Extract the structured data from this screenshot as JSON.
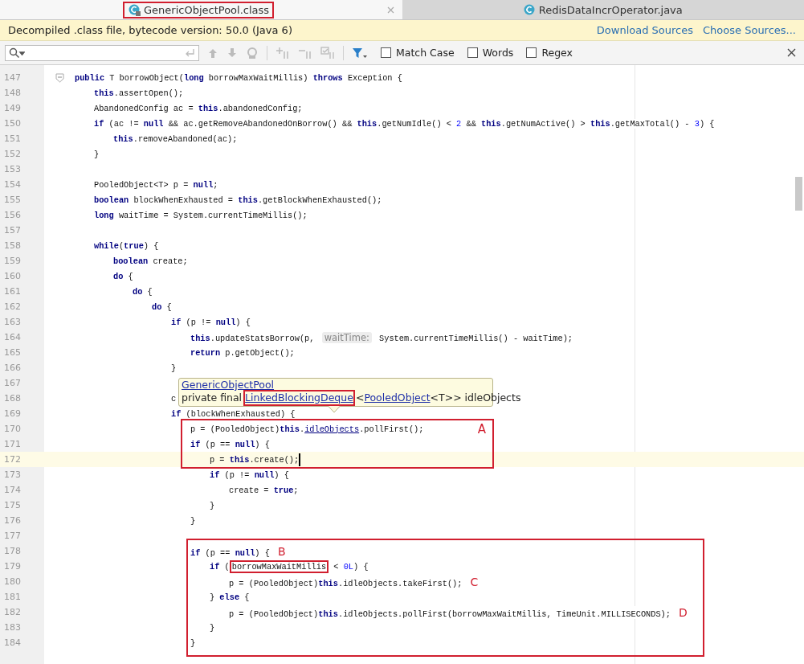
{
  "tabs": [
    {
      "label": "GenericObjectPool.class",
      "selected": true,
      "locked": true,
      "boxed": true
    },
    {
      "label": "RedisDataIncrOperator.java",
      "selected": false,
      "locked": false,
      "boxed": false
    }
  ],
  "banner": {
    "text": "Decompiled .class file, bytecode version: 50.0 (Java 6)",
    "links": [
      "Download Sources",
      "Choose Sources..."
    ]
  },
  "search": {
    "options": [
      {
        "label": "Match Case",
        "checked": false
      },
      {
        "label": "Words",
        "checked": false
      },
      {
        "label": "Regex",
        "checked": false
      }
    ]
  },
  "code": {
    "fold_first_line": true,
    "annotations": [
      {
        "kind": "box",
        "label": "A"
      },
      {
        "kind": "box"
      }
    ],
    "lines": [
      {
        "n": "147",
        "current": false,
        "in_box": false,
        "tokens": [
          {
            "kind": "keyword",
            "text": "public"
          },
          {
            "kind": "plain",
            "text": " T borrowObject("
          },
          {
            "kind": "keyword",
            "text": "long"
          },
          {
            "kind": "plain",
            "text": " borrowMaxWaitMillis) "
          },
          {
            "kind": "keyword",
            "text": "throws"
          },
          {
            "kind": "plain",
            "text": " Exception {"
          }
        ],
        "children": [
          {
            "n": "148",
            "current": false,
            "in_box": false,
            "tokens": [
              {
                "kind": "keyword",
                "text": "this"
              },
              {
                "kind": "plain",
                "text": ".assertOpen();"
              }
            ]
          },
          {
            "n": "149",
            "current": false,
            "in_box": false,
            "tokens": [
              {
                "kind": "plain",
                "text": "AbandonedConfig ac = "
              },
              {
                "kind": "keyword",
                "text": "this"
              },
              {
                "kind": "plain",
                "text": ".abandonedConfig;"
              }
            ]
          },
          {
            "n": "150",
            "current": false,
            "in_box": false,
            "tokens": [
              {
                "kind": "keyword",
                "text": "if"
              },
              {
                "kind": "plain",
                "text": " (ac != "
              },
              {
                "kind": "keyword",
                "text": "null"
              },
              {
                "kind": "plain",
                "text": " && ac.getRemoveAbandonedOnBorrow() && "
              },
              {
                "kind": "keyword",
                "text": "this"
              },
              {
                "kind": "plain",
                "text": ".getNumIdle() < "
              },
              {
                "kind": "number",
                "text": "2"
              },
              {
                "kind": "plain",
                "text": " && "
              },
              {
                "kind": "keyword",
                "text": "this"
              },
              {
                "kind": "plain",
                "text": ".getNumActive() > "
              },
              {
                "kind": "keyword",
                "text": "this"
              },
              {
                "kind": "plain",
                "text": ".getMaxTotal() - "
              },
              {
                "kind": "number",
                "text": "3"
              },
              {
                "kind": "plain",
                "text": ") {"
              }
            ],
            "children": [
              {
                "n": "151",
                "current": false,
                "in_box": false,
                "tokens": [
                  {
                    "kind": "keyword",
                    "text": "this"
                  },
                  {
                    "kind": "plain",
                    "text": ".removeAbandoned(ac);"
                  }
                ]
              }
            ]
          },
          {
            "n": "152",
            "current": false,
            "in_box": false,
            "tokens": [
              {
                "kind": "plain",
                "text": "}"
              }
            ]
          },
          {
            "n": "153",
            "current": false,
            "in_box": false
          },
          {
            "n": "154",
            "current": false,
            "in_box": false,
            "tokens": [
              {
                "kind": "plain",
                "text": "PooledObject<T> p = "
              },
              {
                "kind": "keyword",
                "text": "null"
              },
              {
                "kind": "plain",
                "text": ";"
              }
            ]
          },
          {
            "n": "155",
            "current": false,
            "in_box": false,
            "tokens": [
              {
                "kind": "keyword",
                "text": "boolean"
              },
              {
                "kind": "plain",
                "text": " blockWhenExhausted = "
              },
              {
                "kind": "keyword",
                "text": "this"
              },
              {
                "kind": "plain",
                "text": ".getBlockWhenExhausted();"
              }
            ]
          },
          {
            "n": "156",
            "current": false,
            "in_box": false,
            "tokens": [
              {
                "kind": "keyword",
                "text": "long"
              },
              {
                "kind": "plain",
                "text": " waitTime = System.currentTimeMillis();"
              }
            ]
          },
          {
            "n": "157",
            "current": false,
            "in_box": false
          },
          {
            "n": "158",
            "current": false,
            "in_box": false,
            "tokens": [
              {
                "kind": "keyword",
                "text": "while"
              },
              {
                "kind": "plain",
                "text": "("
              },
              {
                "kind": "keyword",
                "text": "true"
              },
              {
                "kind": "plain",
                "text": ") {"
              }
            ],
            "children": [
              {
                "n": "159",
                "current": false,
                "in_box": false,
                "tokens": [
                  {
                    "kind": "keyword",
                    "text": "boolean"
                  },
                  {
                    "kind": "plain",
                    "text": " create;"
                  }
                ]
              },
              {
                "n": "160",
                "current": false,
                "in_box": false,
                "tokens": [
                  {
                    "kind": "keyword",
                    "text": "do"
                  },
                  {
                    "kind": "plain",
                    "text": " {"
                  }
                ],
                "children": [
                  {
                    "n": "161",
                    "current": false,
                    "in_box": false,
                    "tokens": [
                      {
                        "kind": "keyword",
                        "text": "do"
                      },
                      {
                        "kind": "plain",
                        "text": " {"
                      }
                    ],
                    "children": [
                      {
                        "n": "162",
                        "current": false,
                        "in_box": false,
                        "tokens": [
                          {
                            "kind": "keyword",
                            "text": "do"
                          },
                          {
                            "kind": "plain",
                            "text": " {"
                          }
                        ],
                        "children": [
                          {
                            "n": "163",
                            "current": false,
                            "in_box": false,
                            "tokens": [
                              {
                                "kind": "keyword",
                                "text": "if"
                              },
                              {
                                "kind": "plain",
                                "text": " (p != "
                              },
                              {
                                "kind": "keyword",
                                "text": "null"
                              },
                              {
                                "kind": "plain",
                                "text": ") {"
                              }
                            ],
                            "children": [
                              {
                                "n": "164",
                                "current": false,
                                "in_box": false,
                                "tokens": [
                                  {
                                    "kind": "keyword",
                                    "text": "this"
                                  },
                                  {
                                    "kind": "plain",
                                    "text": ".updateStatsBorrow(p, "
                                  },
                                  {
                                    "kind": "hint",
                                    "text": "waitTime:"
                                  },
                                  {
                                    "kind": "plain",
                                    "text": " System.currentTimeMillis() - waitTime);"
                                  }
                                ]
                              },
                              {
                                "n": "165",
                                "current": false,
                                "in_box": false,
                                "tokens": [
                                  {
                                    "kind": "keyword",
                                    "text": "return"
                                  },
                                  {
                                    "kind": "plain",
                                    "text": " p.getObject();"
                                  }
                                ]
                              }
                            ]
                          },
                          {
                            "n": "166",
                            "current": false,
                            "in_box": false,
                            "tokens": [
                              {
                                "kind": "plain",
                                "text": "}"
                              }
                            ]
                          },
                          {
                            "n": "167",
                            "current": false,
                            "in_box": false
                          },
                          {
                            "n": "168",
                            "current": false,
                            "in_box": false,
                            "tokens": [
                              {
                                "kind": "plain",
                                "text": "c"
                              }
                            ]
                          },
                          {
                            "n": "169",
                            "current": false,
                            "in_box": false,
                            "tokens": [
                              {
                                "kind": "keyword",
                                "text": "if"
                              },
                              {
                                "kind": "plain",
                                "text": " (blockWhenExhausted) {"
                              }
                            ],
                            "children": [
                              {
                                "n": "170",
                                "current": false,
                                "in_box": true,
                                "tokens": [
                                  {
                                    "kind": "plain",
                                    "text": "p = (PooledObject)"
                                  },
                                  {
                                    "kind": "keyword",
                                    "text": "this"
                                  },
                                  {
                                    "kind": "plain",
                                    "text": "."
                                  },
                                  {
                                    "kind": "link",
                                    "text": "idleObjects"
                                  },
                                  {
                                    "kind": "plain",
                                    "text": ".pollFirst();"
                                  }
                                ]
                              },
                              {
                                "n": "171",
                                "current": false,
                                "in_box": true,
                                "tokens": [
                                  {
                                    "kind": "keyword",
                                    "text": "if"
                                  },
                                  {
                                    "kind": "plain",
                                    "text": " (p == "
                                  },
                                  {
                                    "kind": "keyword",
                                    "text": "null"
                                  },
                                  {
                                    "kind": "plain",
                                    "text": ") {"
                                  }
                                ],
                                "children": [
                                  {
                                    "n": "172",
                                    "current": true,
                                    "in_box": true,
                                    "tokens": [
                                      {
                                        "kind": "plain",
                                        "text": "p = "
                                      },
                                      {
                                        "kind": "keyword",
                                        "text": "this"
                                      },
                                      {
                                        "kind": "plain",
                                        "text": ".create();"
                                      }
                                    ]
                                  },
                                  {
                                    "n": "173",
                                    "current": false,
                                    "in_box": false,
                                    "tokens": [
                                      {
                                        "kind": "keyword",
                                        "text": "if"
                                      },
                                      {
                                        "kind": "plain",
                                        "text": " (p != "
                                      },
                                      {
                                        "kind": "keyword",
                                        "text": "null"
                                      },
                                      {
                                        "kind": "plain",
                                        "text": ") {"
                                      }
                                    ],
                                    "children": [
                                      {
                                        "n": "174",
                                        "current": false,
                                        "in_box": false,
                                        "tokens": [
                                          {
                                            "kind": "plain",
                                            "text": "create = "
                                          },
                                          {
                                            "kind": "keyword",
                                            "text": "true"
                                          },
                                          {
                                            "kind": "plain",
                                            "text": ";"
                                          }
                                        ]
                                      }
                                    ]
                                  },
                                  {
                                    "n": "175",
                                    "current": false,
                                    "in_box": false,
                                    "tokens": [
                                      {
                                        "kind": "plain",
                                        "text": "}"
                                      }
                                    ]
                                  }
                                ]
                              },
                              {
                                "n": "176",
                                "current": false,
                                "in_box": false,
                                "tokens": [
                                  {
                                    "kind": "plain",
                                    "text": "}"
                                  }
                                ]
                              },
                              {
                                "n": "177",
                                "current": false,
                                "in_box": false
                              },
                              {
                                "n": "178",
                                "current": false,
                                "in_box": true,
                                "tokens": [
                                  {
                                    "kind": "keyword",
                                    "text": "if"
                                  },
                                  {
                                    "kind": "plain",
                                    "text": " (p == "
                                  },
                                  {
                                    "kind": "keyword",
                                    "text": "null"
                                  },
                                  {
                                    "kind": "plain",
                                    "text": ") {"
                                  },
                                  {
                                    "kind": "mark",
                                    "text": "B"
                                  }
                                ],
                                "children": [
                                  {
                                    "n": "179",
                                    "current": false,
                                    "in_box": true,
                                    "tokens": [
                                      {
                                        "kind": "keyword",
                                        "text": "if"
                                      },
                                      {
                                        "kind": "plain",
                                        "text": " ("
                                      },
                                      {
                                        "kind": "boxed",
                                        "text": "borrowMaxWaitMillis"
                                      },
                                      {
                                        "kind": "plain",
                                        "text": " < "
                                      },
                                      {
                                        "kind": "number",
                                        "text": "0L"
                                      },
                                      {
                                        "kind": "plain",
                                        "text": ") {"
                                      }
                                    ],
                                    "children": [
                                      {
                                        "n": "180",
                                        "current": false,
                                        "in_box": true,
                                        "tokens": [
                                          {
                                            "kind": "plain",
                                            "text": "p = (PooledObject)"
                                          },
                                          {
                                            "kind": "keyword",
                                            "text": "this"
                                          },
                                          {
                                            "kind": "plain",
                                            "text": ".idleObjects.takeFirst();"
                                          },
                                          {
                                            "kind": "mark",
                                            "text": "C"
                                          }
                                        ]
                                      }
                                    ]
                                  },
                                  {
                                    "n": "181",
                                    "current": false,
                                    "in_box": true,
                                    "tokens": [
                                      {
                                        "kind": "plain",
                                        "text": "} "
                                      },
                                      {
                                        "kind": "keyword",
                                        "text": "else"
                                      },
                                      {
                                        "kind": "plain",
                                        "text": " {"
                                      }
                                    ],
                                    "children": [
                                      {
                                        "n": "182",
                                        "current": false,
                                        "in_box": true,
                                        "tokens": [
                                          {
                                            "kind": "plain",
                                            "text": "p = (PooledObject)"
                                          },
                                          {
                                            "kind": "keyword",
                                            "text": "this"
                                          },
                                          {
                                            "kind": "plain",
                                            "text": ".idleObjects.pollFirst(borrowMaxWaitMillis, TimeUnit.MILLISECONDS);"
                                          },
                                          {
                                            "kind": "mark",
                                            "text": "D"
                                          }
                                        ]
                                      }
                                    ]
                                  },
                                  {
                                    "n": "183",
                                    "current": false,
                                    "in_box": true,
                                    "tokens": [
                                      {
                                        "kind": "plain",
                                        "text": "}"
                                      }
                                    ]
                                  }
                                ]
                              },
                              {
                                "n": "184",
                                "current": false,
                                "in_box": true,
                                "tokens": [
                                  {
                                    "kind": "plain",
                                    "text": "}"
                                  }
                                ]
                              }
                            ]
                          }
                        ]
                      }
                    ]
                  }
                ]
              }
            ]
          }
        ]
      }
    ]
  },
  "tooltip": {
    "title_link": "GenericObjectPool",
    "signature": [
      {
        "kind": "text",
        "text": "private final"
      },
      {
        "kind": "link",
        "text": "LinkedBlockingDeque",
        "boxed": true
      },
      {
        "kind": "text",
        "text": "<"
      },
      {
        "kind": "link",
        "text": "PooledObject",
        "boxed": false
      },
      {
        "kind": "text",
        "text": "<T>> idleObjects"
      }
    ]
  }
}
